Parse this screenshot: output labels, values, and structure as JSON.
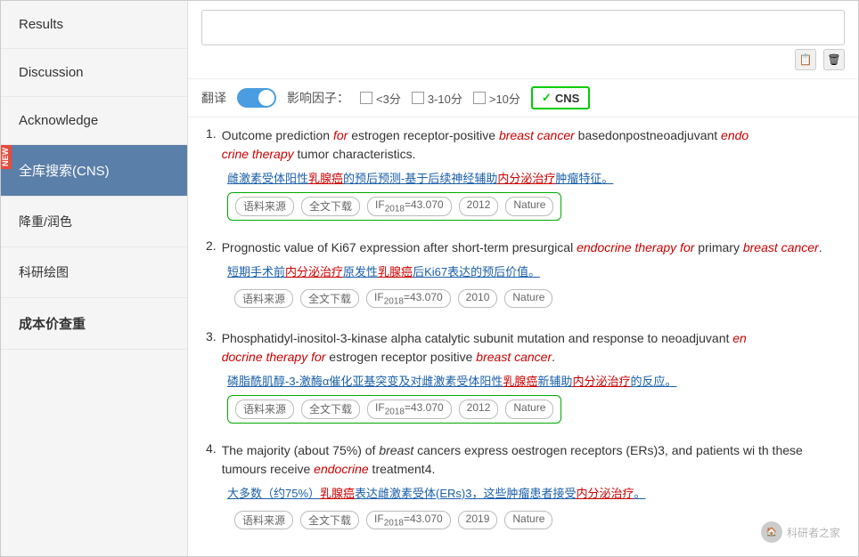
{
  "sidebar": {
    "items": [
      {
        "label": "Results",
        "active": false
      },
      {
        "label": "Discussion",
        "active": false
      },
      {
        "label": "Acknowledge",
        "active": false
      },
      {
        "label": "全库搜索(CNS)",
        "active": true,
        "badge": "NEW"
      },
      {
        "label": "降重/润色",
        "active": false
      },
      {
        "label": "科研绘图",
        "active": false
      },
      {
        "label": "成本价查重",
        "active": false,
        "bold": true
      }
    ]
  },
  "filter_bar": {
    "translate_label": "翻译",
    "impact_factor_label": "影响因子：",
    "option1": "<3分",
    "option2": "3-10分",
    "option3": ">10分",
    "cns_label": "CNS"
  },
  "results": [
    {
      "num": "1.",
      "title_parts": [
        {
          "text": "Outcome prediction ",
          "style": "normal"
        },
        {
          "text": "for",
          "style": "italic-red"
        },
        {
          "text": " estrogen receptor-positive ",
          "style": "normal"
        },
        {
          "text": "breast cancer",
          "style": "italic-red"
        },
        {
          "text": " basedonpostneoadjuvant ",
          "style": "normal"
        },
        {
          "text": "endo crine therapy",
          "style": "italic-red"
        },
        {
          "text": " tumor characteristics.",
          "style": "normal"
        }
      ],
      "title": "Outcome prediction for estrogen receptor-positive breast cancer basedonpostneoadjuvant endocrine therapy tumor characteristics.",
      "cn_text": "雌激素受体阳性乳腺癌的预后预测-基于后续神经辅助内分泌治疗肿瘤特征。",
      "tags": [
        "语料来源",
        "全文下载",
        "IF2018=43.070",
        "2012",
        "Nature"
      ],
      "has_green_border": true
    },
    {
      "num": "2.",
      "title": "Prognostic value of Ki67 expression after short-term presurgical endocrine therapy for primary breast cancer.",
      "cn_text": "短期手术前内分泌治疗原发性乳腺癌后Ki67表达的预后价值。",
      "tags": [
        "语料来源",
        "全文下载",
        "IF2018=43.070",
        "2010",
        "Nature"
      ],
      "has_green_border": false
    },
    {
      "num": "3.",
      "title": "Phosphatidyl-inositol-3-kinase alpha catalytic subunit mutation and response to neoadjuvant endocrine therapy for estrogen receptor positive breast cancer.",
      "cn_text": "磷脂酰肌醇-3-激酶α催化亚基突变及对雌激素受体阳性乳腺癌新辅助内分泌治疗的反应。",
      "tags": [
        "语料来源",
        "全文下载",
        "IF2018=43.070",
        "2012",
        "Nature"
      ],
      "has_green_border": true
    },
    {
      "num": "4.",
      "title": "The majority (about 75%) of breast cancers express oestrogen receptors (ERs)3, and patients with these tumours receive endocrine treatment4.",
      "cn_text": "大多数（约75%）乳腺癌表达雌激素受体(ERs)3，这些肿瘤患者接受内分泌治疗。",
      "tags": [
        "语料来源",
        "全文下载",
        "IF2018=43.070",
        "2019",
        "Nature"
      ],
      "has_green_border": false
    }
  ],
  "watermark": "科研者之家"
}
